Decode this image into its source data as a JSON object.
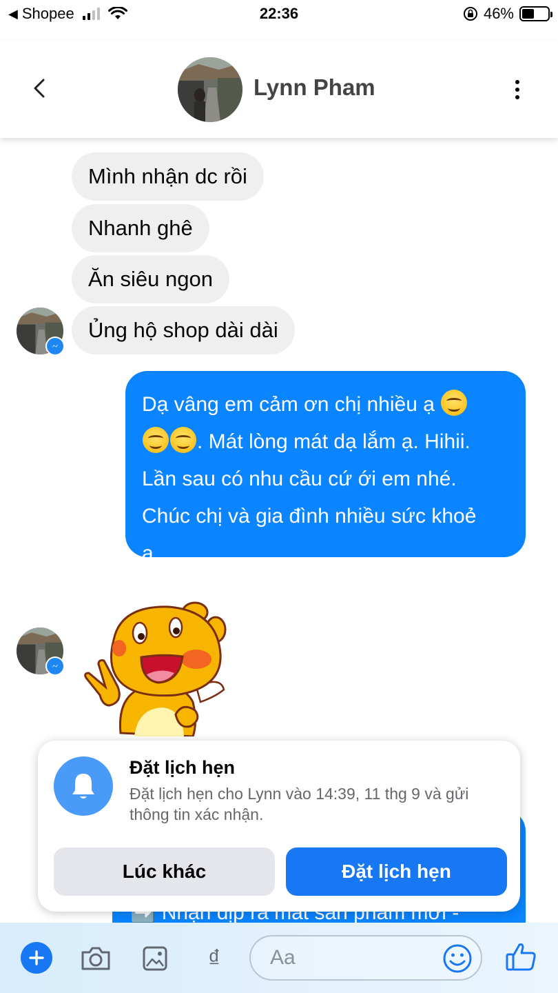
{
  "status_bar": {
    "back_app": "Shopee",
    "time": "22:36",
    "battery_percent": "46%",
    "battery_level": 0.46,
    "icons": [
      "back-arrow-icon",
      "signal-icon",
      "wifi-icon",
      "orientation-lock-icon",
      "battery-icon"
    ]
  },
  "header": {
    "contact_name": "Lynn Pham",
    "icons": [
      "chevron-left-icon",
      "more-vertical-icon"
    ]
  },
  "messages": {
    "incoming": [
      "Mình nhận dc rồi",
      "Nhanh ghê",
      "Ăn siêu ngon",
      "Ủng hộ shop dài dài"
    ],
    "outgoing": {
      "line1": "Dạ vâng em cảm ơn chị nhiều ạ",
      "line2": ". Mát lòng mát dạ lắm ạ. Hihii.",
      "line3": "Lần sau có nhu cầu cứ ới em nhé.",
      "line4": "Chúc chị và gia đình nhiều sức khoẻ",
      "line5": "ạ."
    },
    "hidden_partial": "➡️ Nhận dịp ra mắt sản phẩm mới -"
  },
  "reminder": {
    "title": "Đặt lịch hẹn",
    "description": "Đặt lịch hẹn cho Lynn vào 14:39, 11 thg 9 và gửi thông tin xác nhận.",
    "later_label": "Lúc khác",
    "schedule_label": "Đặt lịch hẹn"
  },
  "composer": {
    "placeholder": "Aa",
    "currency_symbol": "₫"
  },
  "colors": {
    "accent": "#1877f2",
    "outgoing_bubble": "#0a84ff",
    "incoming_bubble": "#efefef"
  }
}
